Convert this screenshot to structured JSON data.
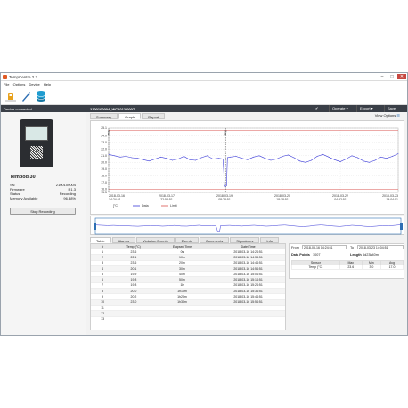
{
  "window": {
    "title": "TempCentre 2.2",
    "controls": [
      "–",
      "□",
      "✕"
    ]
  },
  "menu": [
    "File",
    "Options",
    "Device",
    "Help"
  ],
  "status": {
    "left": "Device connected",
    "file": "2100100004_WC1012/0007",
    "operate": "Operate",
    "export": "Export",
    "save": "Save"
  },
  "device": {
    "name": "Tempod 30",
    "props": [
      {
        "k": "SN",
        "v": "2100100004"
      },
      {
        "k": "Firmware",
        "v": "R1.3"
      },
      {
        "k": "Status",
        "v": "Recording"
      },
      {
        "k": "Memory Available",
        "v": "96.38%"
      }
    ],
    "stop_label": "Stop Recording"
  },
  "tabs_top": [
    {
      "label": "Summary"
    },
    {
      "label": "Graph",
      "active": true
    },
    {
      "label": "Report"
    }
  ],
  "view_options": "View Options",
  "tabs_bottom": [
    {
      "label": "Table",
      "active": true
    },
    {
      "label": "Alarms"
    },
    {
      "label": "Violation Events"
    },
    {
      "label": "Events"
    },
    {
      "label": "Comments"
    },
    {
      "label": "Signatures"
    },
    {
      "label": "Info"
    }
  ],
  "chart_data": {
    "type": "line",
    "ylim": [
      15.5,
      25.1
    ],
    "yticks": [
      "25.1",
      "24.0",
      "23.0",
      "22.0",
      "21.0",
      "20.0",
      "19.0",
      "18.0",
      "17.0",
      "16.0",
      "15.5"
    ],
    "xticks": [
      {
        "t": 0.0,
        "date": "2018-03-16",
        "time": "14:24:51"
      },
      {
        "t": 0.2,
        "date": "2018-03-17",
        "time": "22:58:51"
      },
      {
        "t": 0.4,
        "date": "2018-03-19",
        "time": "08:28:51"
      },
      {
        "t": 0.6,
        "date": "2018-03-20",
        "time": "18:18:51"
      },
      {
        "t": 0.8,
        "date": "2018-03-22",
        "time": "04:32:51"
      },
      {
        "t": 1.0,
        "date": "2018-03-23",
        "time": "14:04:51"
      }
    ],
    "markers": [
      {
        "t": 0.0,
        "label": "Start"
      },
      {
        "t": 0.405,
        "label": "Start"
      }
    ],
    "limit_upper": 24.8,
    "limit_lower": 16.0,
    "legend": [
      {
        "label": "[°C]",
        "color": "#222222"
      },
      {
        "label": "Data",
        "color": "#3b3bd8"
      },
      {
        "label": "Limit",
        "color": "#d9534f"
      }
    ],
    "series": [
      {
        "name": "Data",
        "color": "#3b3bd8",
        "x": [
          0,
          0.02,
          0.04,
          0.06,
          0.08,
          0.1,
          0.12,
          0.14,
          0.16,
          0.18,
          0.2,
          0.22,
          0.24,
          0.26,
          0.28,
          0.3,
          0.32,
          0.34,
          0.36,
          0.38,
          0.395,
          0.4,
          0.403,
          0.407,
          0.41,
          0.42,
          0.44,
          0.46,
          0.48,
          0.5,
          0.52,
          0.54,
          0.56,
          0.58,
          0.6,
          0.62,
          0.64,
          0.66,
          0.68,
          0.7,
          0.72,
          0.74,
          0.76,
          0.78,
          0.8,
          0.82,
          0.84,
          0.86,
          0.88,
          0.9,
          0.92,
          0.94,
          0.96,
          0.98,
          1.0
        ],
        "y": [
          21.2,
          21.0,
          20.8,
          20.9,
          20.7,
          20.6,
          20.4,
          20.2,
          20.5,
          20.8,
          20.6,
          20.3,
          20.5,
          20.9,
          20.4,
          20.3,
          20.7,
          21.0,
          20.5,
          20.6,
          20.5,
          16.5,
          16.4,
          16.5,
          20.7,
          20.8,
          20.9,
          20.6,
          20.4,
          20.8,
          21.0,
          20.6,
          20.3,
          20.5,
          20.9,
          21.1,
          20.7,
          20.2,
          20.0,
          20.3,
          20.9,
          21.2,
          20.8,
          20.4,
          20.1,
          20.5,
          21.0,
          20.7,
          20.2,
          20.0,
          20.3,
          20.8,
          20.6,
          20.9,
          21.3
        ]
      }
    ]
  },
  "table": {
    "headers": [
      "#",
      "Temp (°C)",
      "Elapsed Time",
      "Date/Time"
    ],
    "rows": [
      [
        "1",
        "23.6",
        "0s",
        "2018-03-16 14:24:51"
      ],
      [
        "2",
        "22.1",
        "10m",
        "2018-03-16 14:34:51"
      ],
      [
        "3",
        "23.6",
        "20m",
        "2018-03-16 14:44:51"
      ],
      [
        "4",
        "20.1",
        "30m",
        "2018-03-16 14:54:51"
      ],
      [
        "5",
        "19.9",
        "40m",
        "2018-03-16 15:04:51"
      ],
      [
        "6",
        "19.8",
        "50m",
        "2018-03-16 15:14:51"
      ],
      [
        "7",
        "19.8",
        "1h",
        "2018-03-16 15:24:51"
      ],
      [
        "8",
        "20.0",
        "1h10m",
        "2018-03-16 15:34:51"
      ],
      [
        "9",
        "20.2",
        "1h20m",
        "2018-03-16 15:44:51"
      ],
      [
        "10",
        "23.0",
        "1h30m",
        "2018-03-16 15:54:51"
      ],
      [
        "11",
        "",
        "",
        ""
      ],
      [
        "12",
        "",
        "",
        ""
      ],
      [
        "13",
        "",
        "",
        ""
      ]
    ]
  },
  "summary": {
    "from_label": "From",
    "from": "2018-03-16 14:24:51",
    "to_label": "To",
    "to": "2018-03-23 14:04:51",
    "points_label": "Data Points",
    "points": "1007",
    "length_label": "Length",
    "length": "6d23h40m",
    "headers": [
      "Sensor",
      "Max",
      "Min",
      "Avg"
    ],
    "row": [
      "Temp (°C)",
      "23.6",
      "3.0",
      "17.0"
    ]
  }
}
